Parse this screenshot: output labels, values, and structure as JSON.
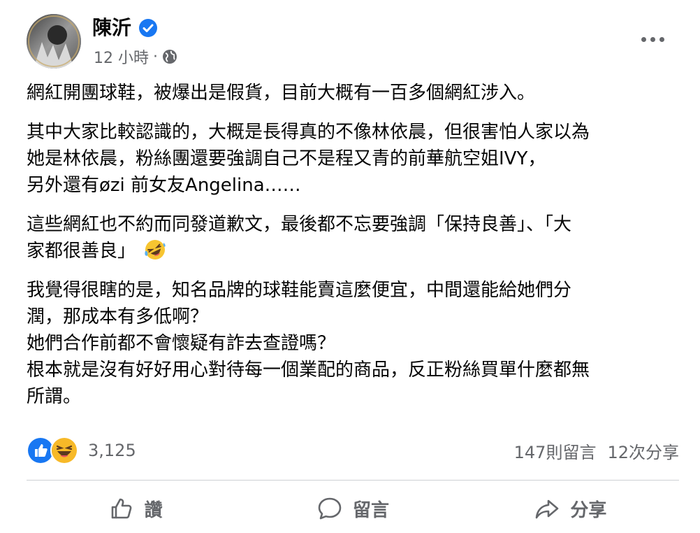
{
  "post": {
    "author": "陳沂",
    "time": "12 小時",
    "separator": "·",
    "paragraphs": [
      [
        "網紅開團球鞋，被爆出是假貨，目前大概有一百多個網紅涉入。"
      ],
      [
        "其中大家比較認識的，大概是長得真的不像林依晨，但很害怕人家以為",
        "她是林依晨，粉絲團還要強調自己不是程又青的前華航空姐IVY，",
        "另外還有øzi 前女友Angelina……"
      ],
      [
        "這些網紅也不約而同發道歉文，最後都不忘要強調「保持良善」、「大",
        "家都很善良」"
      ],
      [
        "我覺得很瞎的是，知名品牌的球鞋能賣這麼便宜，中間還能給她們分",
        "潤，那成本有多低啊？",
        "她們合作前都不會懷疑有詐去查證嗎？",
        "根本就是沒有好好用心對待每一個業配的商品，反正粉絲買單什麼都無",
        "所謂。"
      ]
    ]
  },
  "reactions": {
    "count": "3,125",
    "comments": "147則留言",
    "shares": "12次分享",
    "like_color": "#1877f2",
    "haha_color": "#f7b928"
  },
  "actions": {
    "like": "讚",
    "comment": "留言",
    "share": "分享"
  },
  "icons": [
    "verified-badge-icon",
    "globe-icon",
    "more-icon",
    "like-reaction-icon",
    "haha-reaction-icon",
    "laughing-emoji-icon",
    "thumbs-up-icon",
    "comment-icon",
    "share-icon"
  ]
}
